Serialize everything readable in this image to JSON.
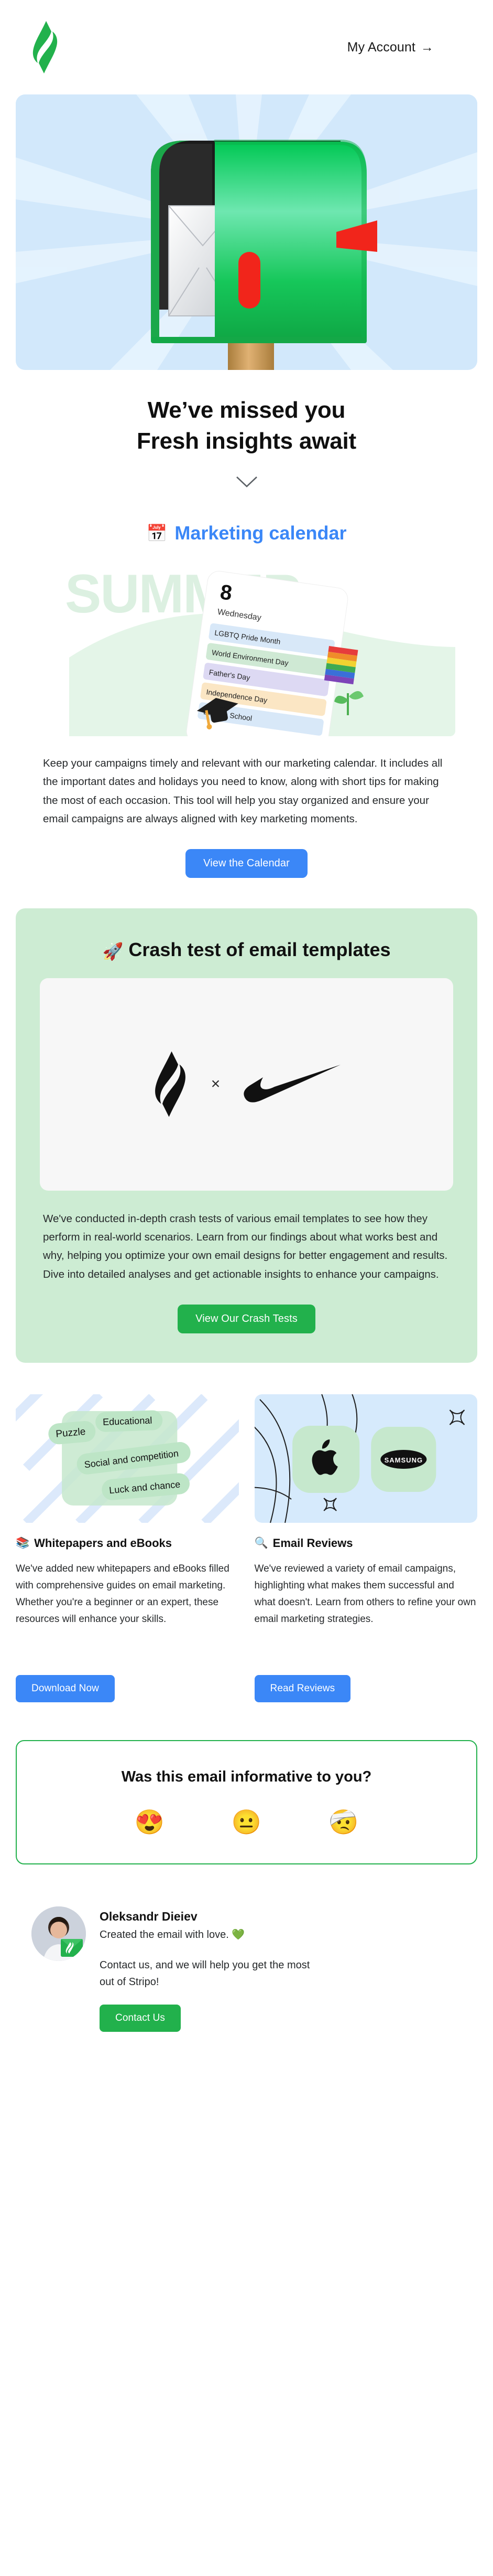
{
  "brand": {
    "logo_icon": "stripo-logo-icon",
    "accent_green": "#22b14c",
    "accent_blue": "#3b87f7",
    "card_green": "#cdecd3",
    "card_blue": "#d6eafc"
  },
  "header": {
    "account_label": "My Account",
    "account_arrow": "→"
  },
  "hero": {
    "image_alt": "green-mailbox-illustration",
    "title_line1": "We’ve missed you",
    "title_line2": "Fresh insights await",
    "scroll_icon": "chevron-down-icon"
  },
  "calendar_section": {
    "emoji": "📅",
    "title": "Marketing calendar",
    "art": {
      "watermark": "SUMMER",
      "day_number": "8",
      "day_name": "Wednesday",
      "events": [
        "LGBTQ Pride Month",
        "World Environment Day",
        "Father's Day",
        "Independence Day",
        "Back to School"
      ],
      "decor_icons": [
        "rainbow-flag-emoji",
        "seedling-emoji",
        "graduation-cap-emoji"
      ]
    },
    "body": "Keep your campaigns timely and relevant with our marketing calendar. It includes all the important dates and holidays you need to know, along with short tips for making the most of each occasion. This tool will help you stay organized and ensure your email campaigns are always aligned with key marketing moments.",
    "cta": "View the Calendar"
  },
  "crash_section": {
    "emoji": "🚀",
    "title": "Crash test of email templates",
    "logos": {
      "left": "stripo-logo-icon",
      "separator": "×",
      "right": "nike-swoosh-icon"
    },
    "body": "We've conducted in-depth crash tests of various email templates to see how they perform in real-world scenarios. Learn from our findings about what works best and why, helping you optimize your own email designs for better engagement and results. Dive into detailed analyses and get actionable insights to enhance your campaigns.",
    "cta": "View Our Crash Tests"
  },
  "columns": [
    {
      "art_tags": [
        "Puzzle",
        "Educational",
        "Social and competition",
        "Luck and chance"
      ],
      "emoji": "📚",
      "title": "Whitepapers and eBooks",
      "body": "We've added new whitepapers and eBooks filled with comprehensive guides on email marketing. Whether you're a beginner or an expert, these resources will enhance your skills.",
      "cta": "Download Now"
    },
    {
      "art_logos": [
        "apple-logo-icon",
        "samsung-logo-icon"
      ],
      "emoji": "🔍",
      "title": "Email Reviews",
      "body": "We've reviewed a variety of email campaigns, highlighting what makes them successful and what doesn't. Learn from others to refine your own email marketing strategies.",
      "cta": "Read Reviews"
    }
  ],
  "feedback": {
    "question": "Was this email informative to you?",
    "options": [
      {
        "emoji": "😍",
        "name": "rating-love"
      },
      {
        "emoji": "😐",
        "name": "rating-neutral"
      },
      {
        "emoji": "🤕",
        "name": "rating-bad"
      }
    ]
  },
  "signature": {
    "avatar_alt": "author-portrait",
    "name": "Oleksandr Dieiev",
    "subtitle": "Created the email with love.",
    "heart": "💚",
    "note": "Contact us, and we will help you get the most out of Stripo!",
    "cta": "Contact Us"
  }
}
